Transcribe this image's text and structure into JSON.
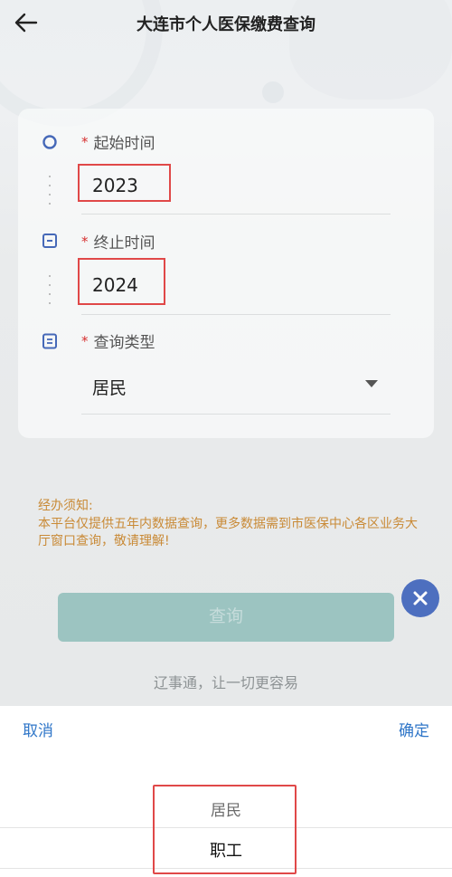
{
  "header": {
    "title": "大连市个人医保缴费查询",
    "back_icon": "arrow-left-icon"
  },
  "form": {
    "start": {
      "required_mark": "*",
      "label": "起始时间",
      "value": "2023",
      "icon": "circle-icon"
    },
    "end": {
      "required_mark": "*",
      "label": "终止时间",
      "value": "2024",
      "icon": "calendar-icon"
    },
    "type": {
      "required_mark": "*",
      "label": "查询类型",
      "value": "居民",
      "icon": "document-icon"
    }
  },
  "notice": {
    "title": "经办须知:",
    "body": "本平台仅提供五年内数据查询，更多数据需到市医保中心各区业务大厅窗口查询，敬请理解!"
  },
  "query_button": {
    "label": "查询"
  },
  "close_button": {
    "icon": "close-icon"
  },
  "slogan": "辽事通，让一切更容易",
  "picker": {
    "cancel_label": "取消",
    "confirm_label": "确定",
    "options": [
      "居民",
      "职工"
    ],
    "selected": "职工"
  },
  "colors": {
    "accent_blue": "#2f76c8",
    "notice_orange": "#c98a36",
    "highlight_red": "#e04848",
    "button_teal": "#9cc4c1",
    "close_fab": "#4d6fbf"
  }
}
